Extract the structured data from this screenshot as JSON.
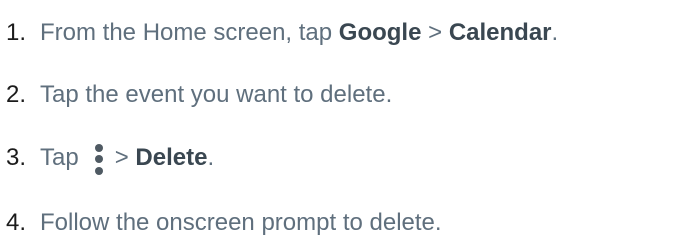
{
  "steps": [
    {
      "number": "1.",
      "text_1": "From the Home screen, tap ",
      "bold_1": "Google",
      "text_2": " > ",
      "bold_2": "Calendar",
      "text_3": "."
    },
    {
      "number": "2.",
      "text_1": "Tap the event you want to delete."
    },
    {
      "number": "3.",
      "text_1": "Tap",
      "icon": "more-vertical-icon",
      "text_2": "> ",
      "bold_1": "Delete",
      "text_3": "."
    },
    {
      "number": "4.",
      "text_1": "Follow the onscreen prompt to delete."
    }
  ]
}
